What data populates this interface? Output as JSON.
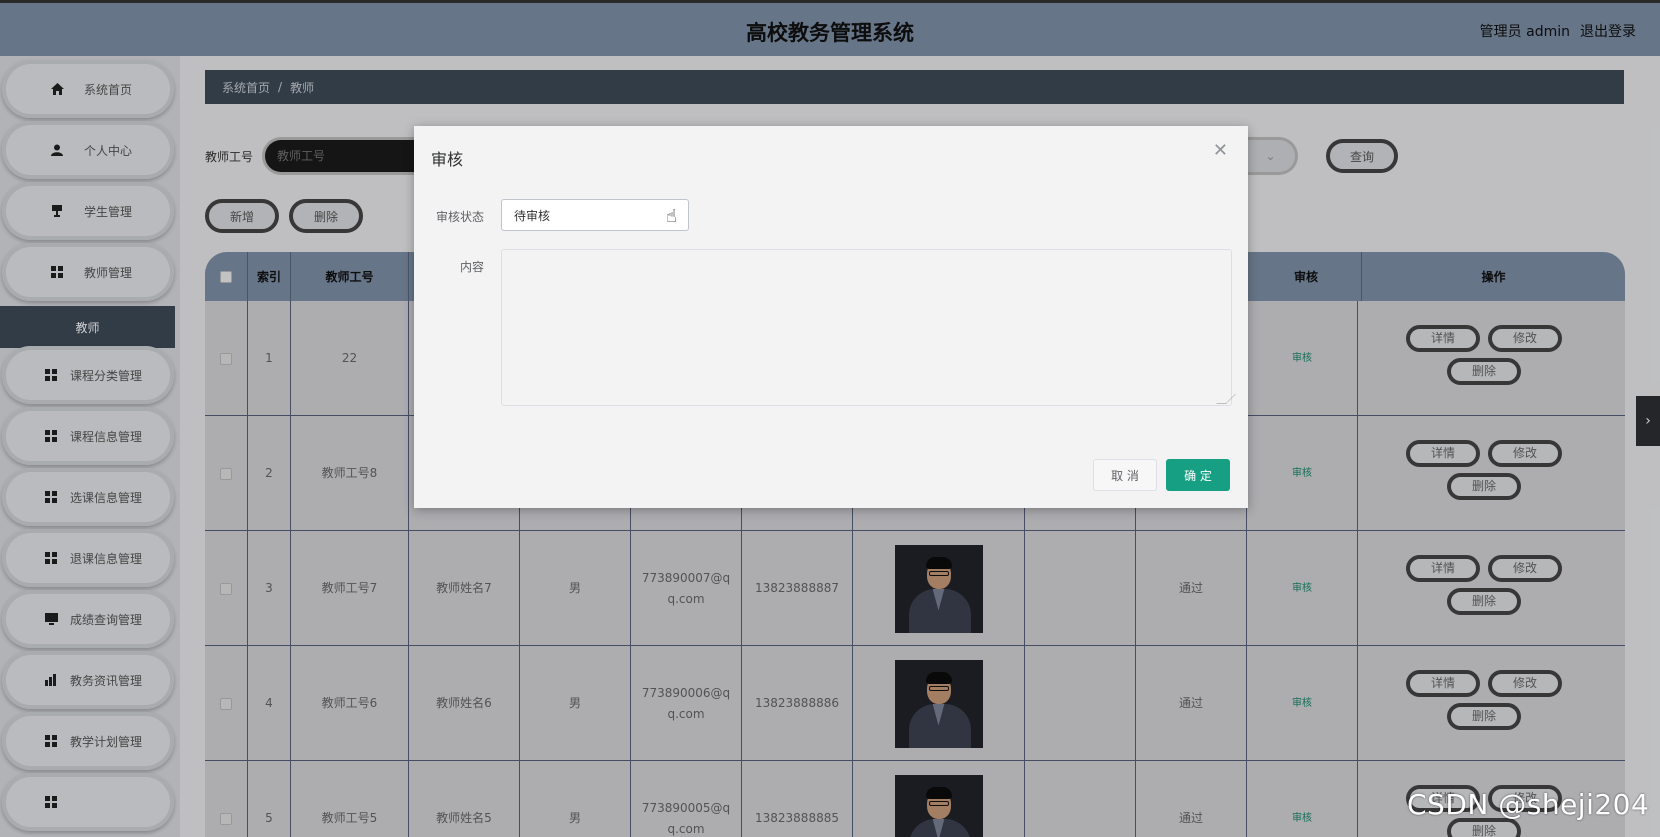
{
  "header": {
    "title": "高校教务管理系统",
    "user": "管理员 admin",
    "logout": "退出登录"
  },
  "sidebar": {
    "items": [
      {
        "label": "系统首页",
        "icon": "home-icon"
      },
      {
        "label": "个人中心",
        "icon": "user-icon"
      },
      {
        "label": "学生管理",
        "icon": "student-icon"
      },
      {
        "label": "教师管理",
        "icon": "grid-icon"
      },
      {
        "label": "课程分类管理",
        "icon": "grid-icon"
      },
      {
        "label": "课程信息管理",
        "icon": "grid-icon"
      },
      {
        "label": "选课信息管理",
        "icon": "grid-icon"
      },
      {
        "label": "退课信息管理",
        "icon": "grid-icon"
      },
      {
        "label": "成绩查询管理",
        "icon": "monitor-icon"
      },
      {
        "label": "教务资讯管理",
        "icon": "chart-icon"
      },
      {
        "label": "教学计划管理",
        "icon": "grid-icon"
      }
    ],
    "active_sub": "教师"
  },
  "breadcrumb": {
    "home": "系统首页",
    "sep": "/",
    "current": "教师"
  },
  "search": {
    "label": "教师工号",
    "placeholder": "教师工号",
    "query_button": "查询"
  },
  "toolbar": {
    "add": "新增",
    "delete": "删除"
  },
  "table": {
    "headers": {
      "index": "索引",
      "teacher_id": "教师工号",
      "audit": "审核",
      "actions": "操作"
    },
    "rows": [
      {
        "index": "1",
        "teacher_id": "22",
        "name": "",
        "gender": "",
        "email": "",
        "phone": "",
        "status": ""
      },
      {
        "index": "2",
        "teacher_id": "教师工号8",
        "name": "",
        "gender": "",
        "email": "",
        "phone": "",
        "status": ""
      },
      {
        "index": "3",
        "teacher_id": "教师工号7",
        "name": "教师姓名7",
        "gender": "男",
        "email": "773890007@qq.com",
        "phone": "13823888887",
        "status": "通过"
      },
      {
        "index": "4",
        "teacher_id": "教师工号6",
        "name": "教师姓名6",
        "gender": "男",
        "email": "773890006@qq.com",
        "phone": "13823888886",
        "status": "通过"
      },
      {
        "index": "5",
        "teacher_id": "教师工号5",
        "name": "教师姓名5",
        "gender": "男",
        "email": "773890005@qq.com",
        "phone": "13823888885",
        "status": "通过"
      }
    ],
    "audit_link": "审核",
    "row_actions": {
      "detail": "详情",
      "edit": "修改",
      "delete": "删除"
    }
  },
  "dialog": {
    "title": "审核",
    "status_label": "审核状态",
    "status_value": "待审核",
    "content_label": "内容",
    "cancel": "取 消",
    "confirm": "确 定"
  },
  "watermark": "CSDN @sheji204",
  "colors": {
    "accent": "#169f83",
    "header": "#7d8fa6",
    "sidebar_active": "#3d4a57"
  }
}
